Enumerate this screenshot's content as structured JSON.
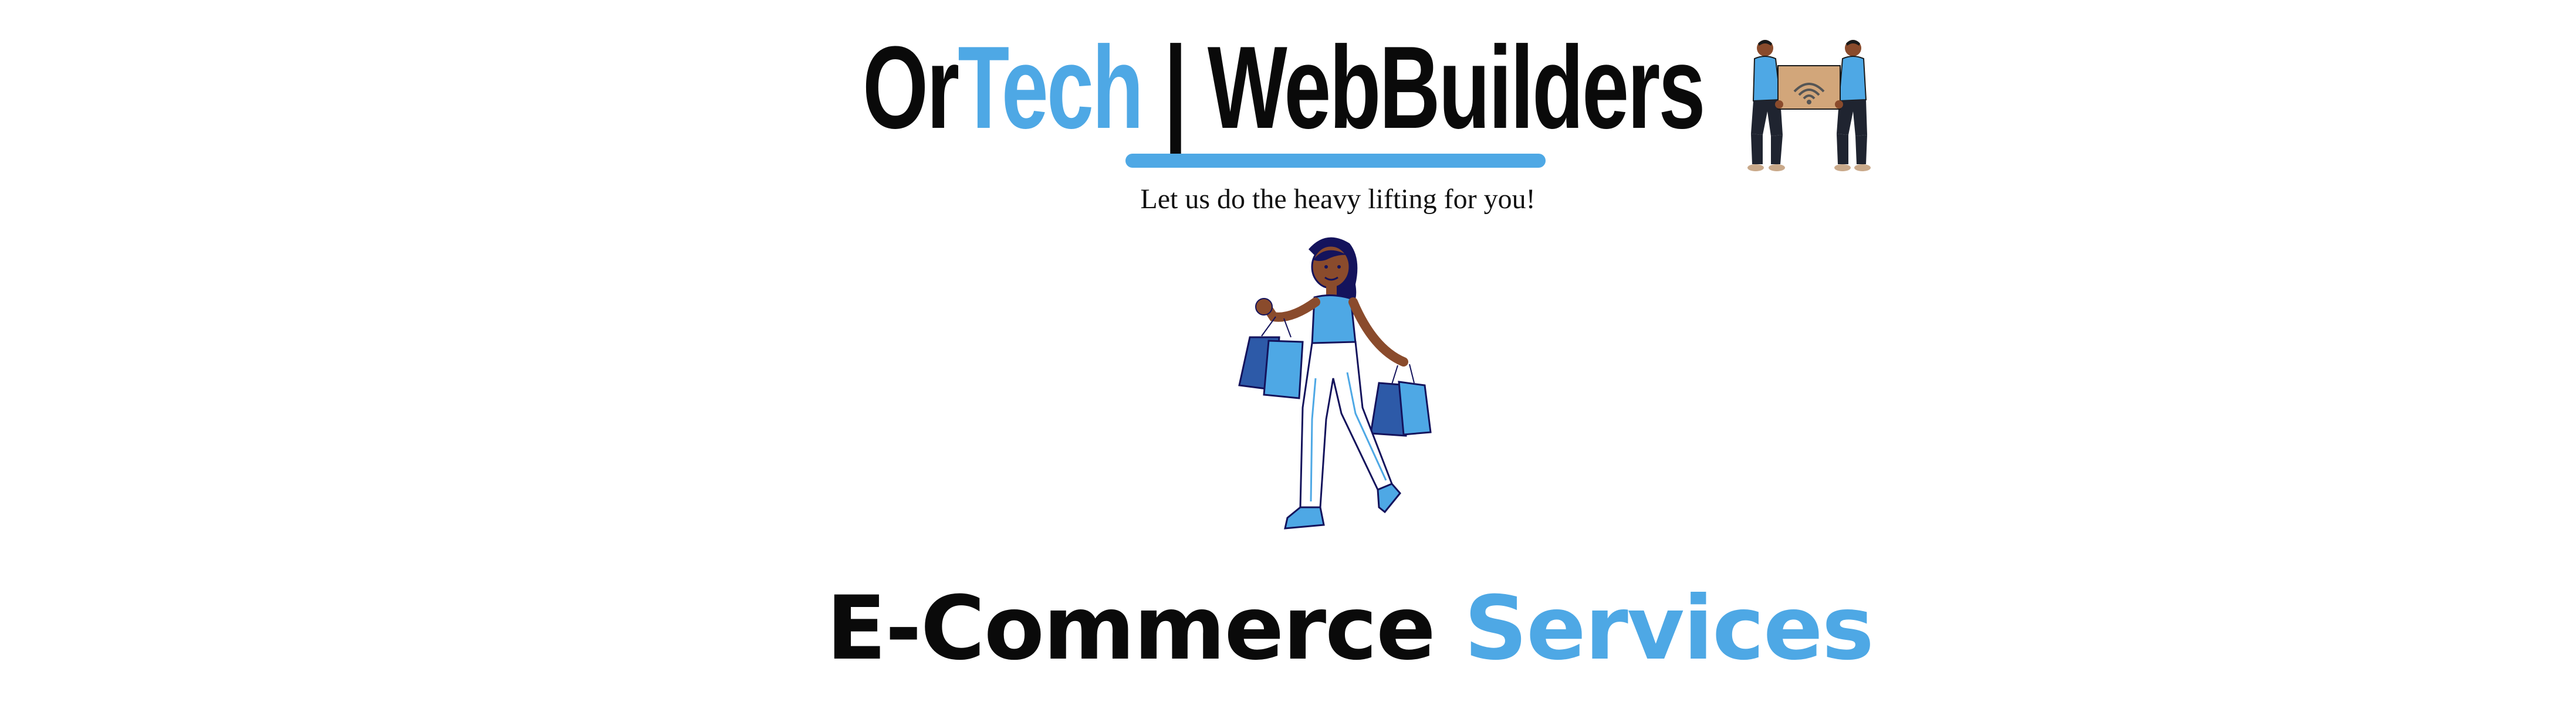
{
  "brand": {
    "name_part1": "Or",
    "name_accent": "Tech",
    "name_rest": " | WebBuilders"
  },
  "tagline": "Let us do the heavy lifting for you!",
  "heading": {
    "main": "E-Commerce",
    "accent": " Services"
  },
  "colors": {
    "accent": "#4ea8e5",
    "text": "#0a0a0a",
    "skin": "#8a4b2c",
    "hair": "#14135c"
  },
  "illustrations": {
    "movers": "two-people-carrying-wifi-box-icon",
    "shopper": "woman-with-shopping-bags-illustration"
  }
}
